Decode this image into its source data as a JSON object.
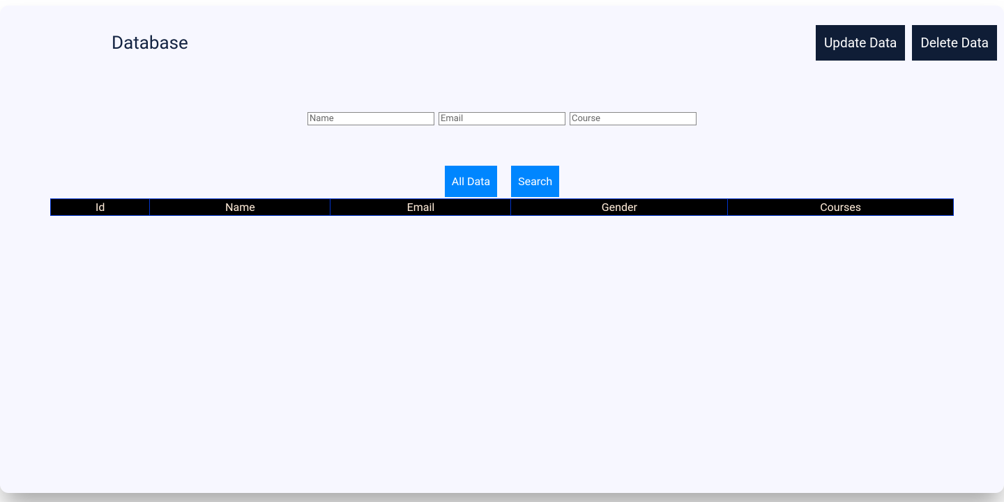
{
  "header": {
    "title": "Database",
    "update_label": "Update Data",
    "delete_label": "Delete Data"
  },
  "search": {
    "name_placeholder": "Name",
    "email_placeholder": "Email",
    "course_placeholder": "Course"
  },
  "actions": {
    "all_data_label": "All Data",
    "search_label": "Search"
  },
  "table": {
    "columns": [
      "Id",
      "Name",
      "Email",
      "Gender",
      "Courses"
    ],
    "rows": []
  }
}
